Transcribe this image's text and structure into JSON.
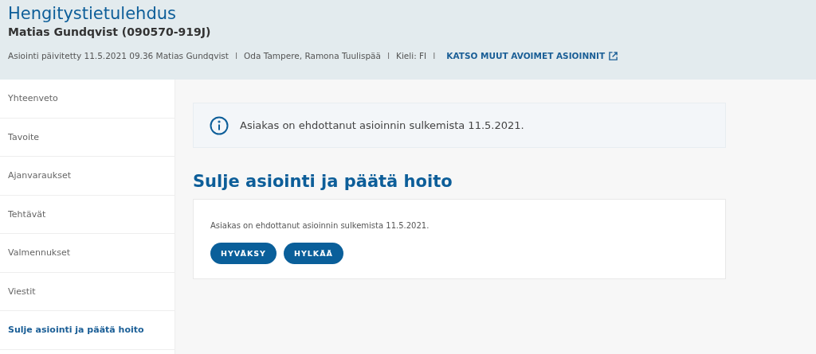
{
  "header": {
    "title": "Hengitystietulehdus",
    "subtitle": "Matias Gundqvist (090570-919J)",
    "meta": [
      {
        "kind": "text",
        "text": "Asiointi päivitetty 11.5.2021 09.36 Matias Gundqvist"
      },
      {
        "kind": "separator",
        "text": "I"
      },
      {
        "kind": "text",
        "text": "Oda Tampere, Ramona Tuulispää"
      },
      {
        "kind": "separator",
        "text": "I"
      },
      {
        "kind": "text",
        "text": "Kieli: FI"
      },
      {
        "kind": "separator",
        "text": "I"
      },
      {
        "kind": "link",
        "text": "KATSO MUUT AVOIMET ASIOINNIT"
      }
    ]
  },
  "sidebar": {
    "items": [
      {
        "label": "Yhteenveto",
        "selected": false
      },
      {
        "label": "Tavoite",
        "selected": false
      },
      {
        "label": "Ajanvaraukset",
        "selected": false
      },
      {
        "label": "Tehtävät",
        "selected": false
      },
      {
        "label": "Valmennukset",
        "selected": false
      },
      {
        "label": "Viestit",
        "selected": false
      },
      {
        "label": "Sulje asiointi ja päätä hoito",
        "selected": true
      }
    ]
  },
  "notice": {
    "text": "Asiakas on ehdottanut asioinnin sulkemista 11.5.2021."
  },
  "section": {
    "heading": "Sulje asiointi ja päätä hoito",
    "text": "Asiakas on ehdottanut asioinnin sulkemista 11.5.2021.",
    "buttons": [
      "HYVÄKSY",
      "HYLKÄÄ"
    ]
  }
}
